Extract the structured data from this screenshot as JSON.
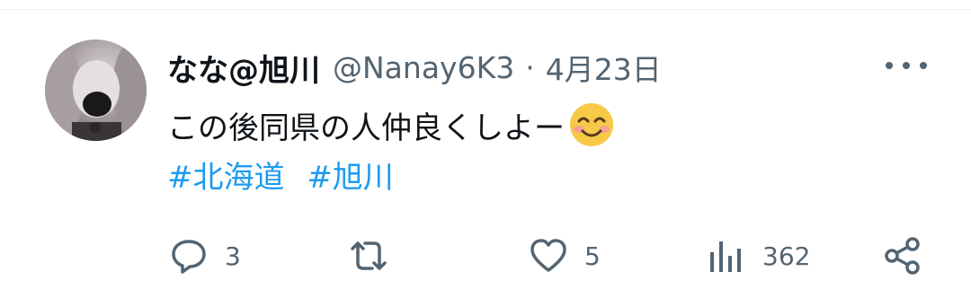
{
  "tweet": {
    "display_name": "なな@旭川",
    "handle": "@Nanay6K3",
    "separator": "·",
    "date": "4月23日",
    "text": "この後同県の人仲良くしよー",
    "emoji": "smiling-face-with-smiling-eyes",
    "hashtags": [
      "#北海道",
      "#旭川"
    ]
  },
  "actions": {
    "reply_count": "3",
    "retweet_count": "",
    "like_count": "5",
    "view_count": "362"
  },
  "colors": {
    "text": "#0f1419",
    "secondary": "#536471",
    "link": "#1d9bf0",
    "emoji_face": "#f7c948"
  }
}
